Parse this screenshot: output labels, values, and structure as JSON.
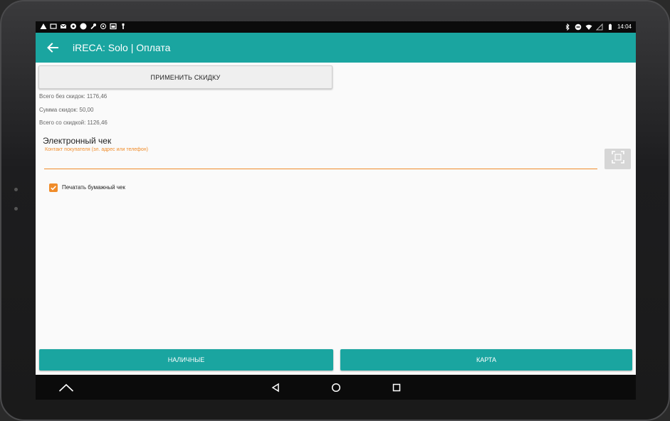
{
  "status_bar": {
    "time": "14:04",
    "left_icons": [
      "warning-icon",
      "image-icon",
      "mail-icon",
      "settings-icon",
      "circle-icon",
      "wrench-icon",
      "location-icon",
      "calendar-icon",
      "figure-icon"
    ],
    "right_icons": [
      "bluetooth-icon",
      "dnd-icon",
      "wifi-icon",
      "signal-icon",
      "battery-icon"
    ]
  },
  "app_bar": {
    "title": "iRECA: Solo | Оплата"
  },
  "discount": {
    "button_label": "ПРИМЕНИТЬ СКИДКУ"
  },
  "summary": {
    "total_without_discount": "Всего без скидок: 1176,46",
    "discount_sum": "Сумма скидок: 50,00",
    "total_with_discount": "Всего со скидкой: 1126,46"
  },
  "ereceipt": {
    "title": "Электронный чек",
    "input_hint": "Контакт покупателя (эл. адрес или телефон)",
    "input_value": ""
  },
  "paper_receipt": {
    "label": "Печатать бумажный чек",
    "checked": true
  },
  "payment": {
    "cash_label": "НАЛИЧНЫЕ",
    "card_label": "КАРТА"
  },
  "colors": {
    "accent": "#1aa5a0",
    "highlight": "#f08c2a"
  }
}
